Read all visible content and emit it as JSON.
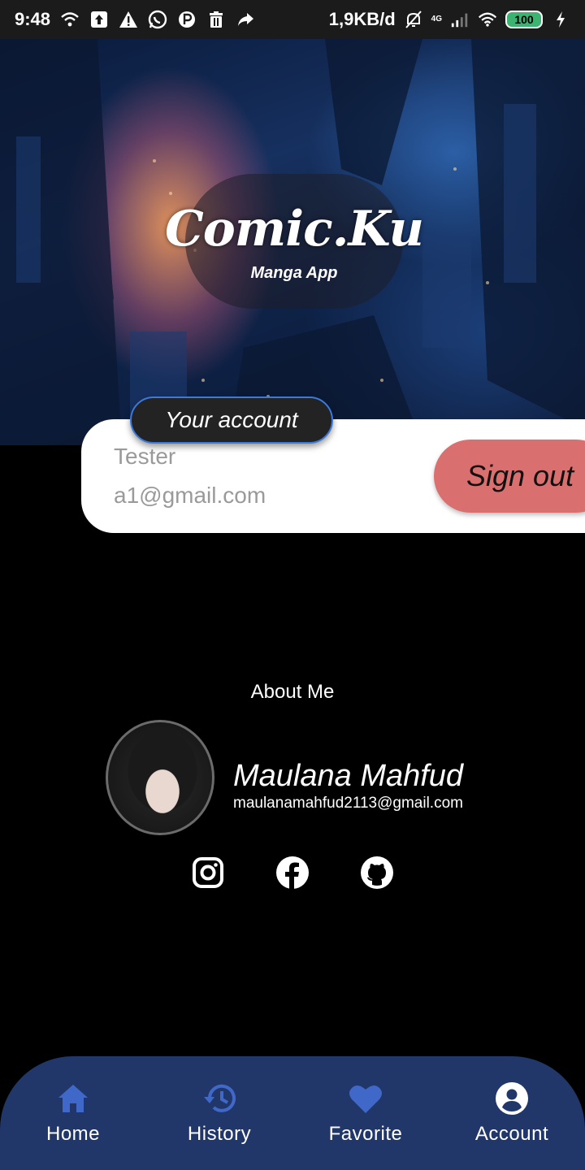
{
  "status_bar": {
    "time": "9:48",
    "network_speed": "1,9KB/d",
    "network_type": "4G",
    "battery": "100",
    "icons": [
      "wifi-icon",
      "upload-icon",
      "warning-icon",
      "whatsapp-icon",
      "p-icon",
      "trash-icon",
      "share-icon",
      "mute-icon",
      "signal-icon",
      "wifi-icon",
      "battery-icon",
      "charging-icon"
    ]
  },
  "hero": {
    "app_title": "Comic.Ku",
    "app_subtitle": "Manga App"
  },
  "account": {
    "section_label": "Your account",
    "username": "Tester",
    "email": "a1@gmail.com",
    "signout_label": "Sign out",
    "signout_color": "#d9706f"
  },
  "about": {
    "title": "About Me",
    "developer_name": "Maulana Mahfud",
    "developer_email": "maulanamahfud2113@gmail.com",
    "social_links": [
      "instagram-icon",
      "facebook-icon",
      "github-icon"
    ]
  },
  "bottom_nav": {
    "background": "#223769",
    "accent": "#3f68c8",
    "items": [
      {
        "label": "Home",
        "icon": "home-icon"
      },
      {
        "label": "History",
        "icon": "history-icon"
      },
      {
        "label": "Favorite",
        "icon": "heart-icon"
      },
      {
        "label": "Account",
        "icon": "account-icon"
      }
    ],
    "active_index": 3
  }
}
